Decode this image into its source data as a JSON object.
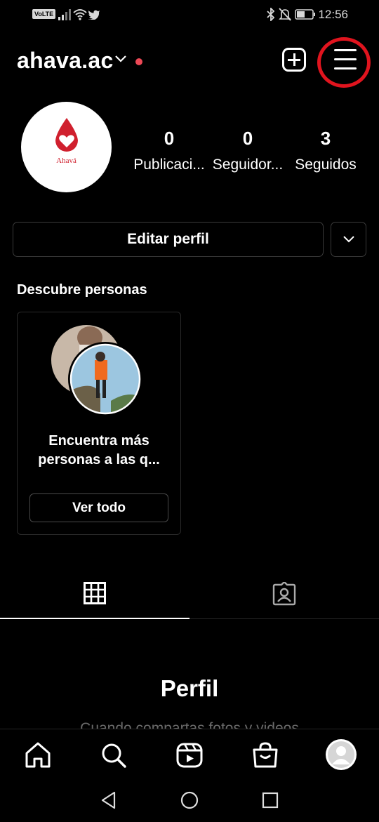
{
  "status_bar": {
    "network_badge": "VoLTE",
    "time": "12:56",
    "icons": [
      "signal-icon",
      "wifi-icon",
      "twitter-icon",
      "bluetooth-icon",
      "mute-icon",
      "battery-icon"
    ]
  },
  "header": {
    "username": "ahava.ac",
    "icons": [
      "chevron-down-icon",
      "new-post-icon",
      "menu-icon"
    ],
    "accent_color": "#ed4956",
    "highlight_ring_color": "#e0141e"
  },
  "profile": {
    "logo_text": "Ahavá",
    "stats": [
      {
        "value": "0",
        "label": "Publicaci..."
      },
      {
        "value": "0",
        "label": "Seguidor..."
      },
      {
        "value": "3",
        "label": "Seguidos"
      }
    ]
  },
  "actions": {
    "edit_profile": "Editar perfil"
  },
  "discover": {
    "title": "Descubre personas",
    "card_text_line1": "Encuentra más",
    "card_text_line2": "personas a las q...",
    "see_all": "Ver todo"
  },
  "tabs": [
    "grid-icon",
    "tagged-icon"
  ],
  "empty_state": {
    "title": "Perfil",
    "subtitle": "Cuando compartas fotos y videos"
  },
  "bottom_nav": [
    "home-icon",
    "search-icon",
    "reels-icon",
    "shop-icon",
    "profile-avatar"
  ]
}
